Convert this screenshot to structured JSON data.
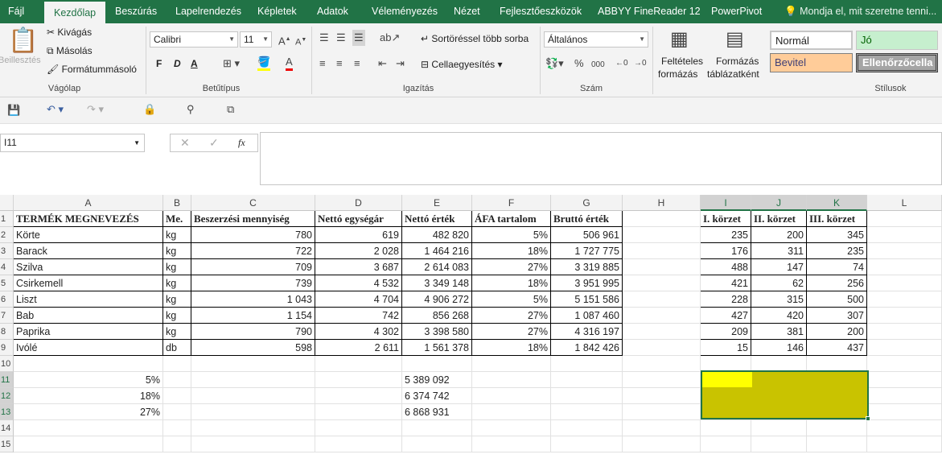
{
  "tabs": [
    "Fájl",
    "Kezdőlap",
    "Beszúrás",
    "Lapelrendezés",
    "Képletek",
    "Adatok",
    "Véleményezés",
    "Nézet",
    "Fejlesztőeszközök",
    "ABBYY FineReader 12",
    "PowerPivot"
  ],
  "tellme": "Mondja el, mit szeretne tenni...",
  "ribbon": {
    "clipboard": {
      "paste": "Beillesztés",
      "cut": "Kivágás",
      "copy": "Másolás",
      "format_painter": "Formátummásoló",
      "label": "Vágólap"
    },
    "font": {
      "name": "Calibri",
      "size": "11",
      "bold": "F",
      "italic": "D",
      "underline": "A",
      "label": "Betűtípus"
    },
    "align": {
      "wrap": "Sortöréssel több sorba",
      "merge": "Cellaegyesítés",
      "label": "Igazítás"
    },
    "number": {
      "format": "Általános",
      "label": "Szám"
    },
    "cond": {
      "line1": "Feltételes",
      "line2": "formázás"
    },
    "table": {
      "line1": "Formázás",
      "line2": "táblázatként"
    },
    "styles": {
      "normal": "Normál",
      "good": "Jó",
      "input": "Bevitel",
      "check": "Ellenőrzőcella",
      "label": "Stílusok"
    }
  },
  "namebox": "I11",
  "columns": [
    "A",
    "B",
    "C",
    "D",
    "E",
    "F",
    "G",
    "H",
    "I",
    "J",
    "K",
    "L"
  ],
  "rows": [
    "1",
    "2",
    "3",
    "4",
    "5",
    "6",
    "7",
    "8",
    "9",
    "10",
    "11",
    "12",
    "13",
    "14",
    "15"
  ],
  "table": {
    "headers": [
      "TERMÉK MEGNEVEZÉS",
      "Me.",
      "Beszerzési mennyiség",
      "Nettó egységár",
      "Nettó érték",
      "ÁFA tartalom",
      "Bruttó érték"
    ],
    "rows": [
      [
        "Körte",
        "kg",
        "780",
        "619",
        "482 820",
        "5%",
        "506 961"
      ],
      [
        "Barack",
        "kg",
        "722",
        "2 028",
        "1 464 216",
        "18%",
        "1 727 775"
      ],
      [
        "Szilva",
        "kg",
        "709",
        "3 687",
        "2 614 083",
        "27%",
        "3 319 885"
      ],
      [
        "Csirkemell",
        "kg",
        "739",
        "4 532",
        "3 349 148",
        "18%",
        "3 951 995"
      ],
      [
        "Liszt",
        "kg",
        "1 043",
        "4 704",
        "4 906 272",
        "5%",
        "5 151 586"
      ],
      [
        "Bab",
        "kg",
        "1 154",
        "742",
        "856 268",
        "27%",
        "1 087 460"
      ],
      [
        "Paprika",
        "kg",
        "790",
        "4 302",
        "3 398 580",
        "27%",
        "4 316 197"
      ],
      [
        "Ivólé",
        "db",
        "598",
        "2 611",
        "1 561 378",
        "18%",
        "1 842 426"
      ]
    ]
  },
  "district": {
    "headers": [
      "I. körzet",
      "II. körzet",
      "III. körzet"
    ],
    "rows": [
      [
        "235",
        "200",
        "345"
      ],
      [
        "176",
        "311",
        "235"
      ],
      [
        "488",
        "147",
        "74"
      ],
      [
        "421",
        "62",
        "256"
      ],
      [
        "228",
        "315",
        "500"
      ],
      [
        "427",
        "420",
        "307"
      ],
      [
        "209",
        "381",
        "200"
      ],
      [
        "15",
        "146",
        "437"
      ]
    ]
  },
  "summary": [
    [
      "5%",
      "5 389 092"
    ],
    [
      "18%",
      "6 374 742"
    ],
    [
      "27%",
      "6 868 931"
    ]
  ],
  "colors": {
    "excel_green": "#217346",
    "yellow": "#ffff00",
    "olive": "#c9c300",
    "style_good": "#c6efce",
    "style_input": "#ffcc99"
  }
}
